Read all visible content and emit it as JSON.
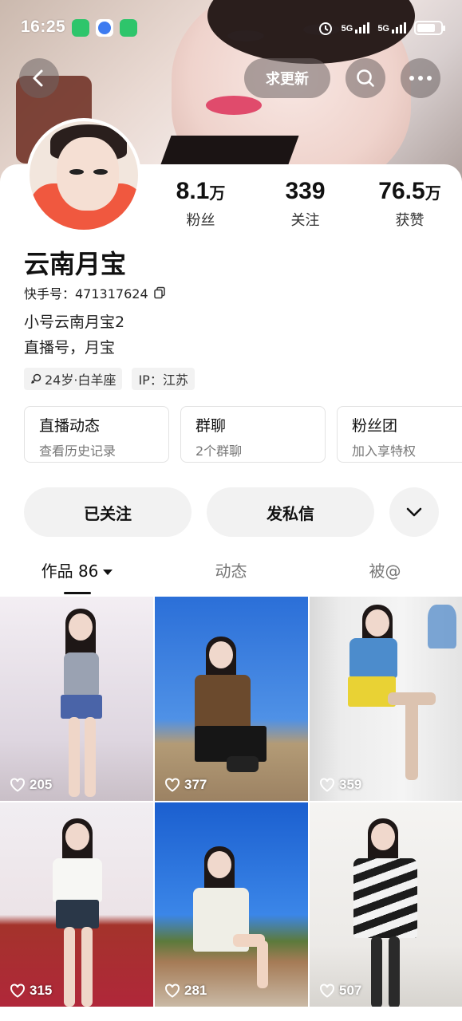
{
  "status_bar": {
    "time": "16:25",
    "network_1": "5G",
    "network_2": "5G",
    "battery_level": 0.8
  },
  "nav": {
    "update_label": "求更新"
  },
  "profile": {
    "stats": [
      {
        "value": "8.1",
        "unit": "万",
        "label": "粉丝"
      },
      {
        "value": "339",
        "unit": "",
        "label": "关注"
      },
      {
        "value": "76.5",
        "unit": "万",
        "label": "获赞"
      }
    ],
    "name": "云南月宝",
    "kuaishou_id": "快手号：471317624",
    "bio_line_1": "小号云南月宝2",
    "bio_line_2": "直播号，月宝",
    "tag_age": "24岁·白羊座",
    "tag_ip": "IP：江苏"
  },
  "quick_entries": [
    {
      "title": "直播动态",
      "subtitle": "查看历史记录"
    },
    {
      "title": "群聊",
      "subtitle": "2个群聊"
    },
    {
      "title": "粉丝团",
      "subtitle": "加入享特权"
    }
  ],
  "actions": {
    "followed_label": "已关注",
    "message_label": "发私信"
  },
  "tabs": {
    "works": "作品 86",
    "moments": "动态",
    "mentions": "被@"
  },
  "videos": [
    {
      "likes": "205"
    },
    {
      "likes": "377"
    },
    {
      "likes": "359"
    },
    {
      "likes": "315"
    },
    {
      "likes": "281"
    },
    {
      "likes": "507"
    }
  ],
  "colors": {
    "accent_red": "#e04b6c",
    "card_bg": "#ffffff",
    "chip_bg": "#f2f2f2"
  }
}
